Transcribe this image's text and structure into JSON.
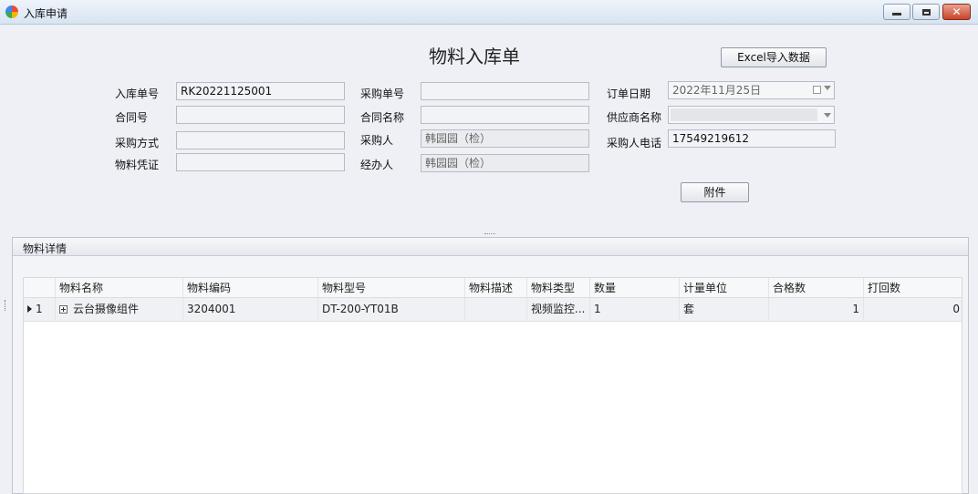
{
  "window": {
    "title": "入库申请"
  },
  "form": {
    "title": "物料入库单",
    "excel_button": "Excel导入数据",
    "attach_button": "附件",
    "fields": {
      "inbound_no": {
        "label": "入库单号",
        "value": "RK20221125001"
      },
      "contract_no": {
        "label": "合同号",
        "value": ""
      },
      "purchase_method": {
        "label": "采购方式",
        "value": ""
      },
      "material_voucher": {
        "label": "物料凭证",
        "value": ""
      },
      "purchase_no": {
        "label": "采购单号",
        "value": ""
      },
      "contract_name": {
        "label": "合同名称",
        "value": ""
      },
      "purchaser": {
        "label": "采购人",
        "value": "韩园园（检）"
      },
      "handler": {
        "label": "经办人",
        "value": "韩园园（检）"
      },
      "order_date": {
        "label": "订单日期",
        "value": "2022年11月25日"
      },
      "supplier_name": {
        "label": "供应商名称",
        "value": ""
      },
      "purchaser_phone": {
        "label": "采购人电话",
        "value": "17549219612"
      }
    }
  },
  "details": {
    "title": "物料详情",
    "columns": [
      "物料名称",
      "物料编码",
      "物料型号",
      "物料描述",
      "物料类型",
      "数量",
      "计量单位",
      "合格数",
      "打回数"
    ],
    "rows": [
      {
        "index": "1",
        "name": "云台摄像组件",
        "code": "3204001",
        "model": "DT-200-YT01B",
        "description": "",
        "type": "视频监控...",
        "quantity": "1",
        "unit": "套",
        "qualified": "1",
        "returned": "0"
      }
    ]
  },
  "icons": {
    "app": "app-logo-icon",
    "minimize": "minimize-icon",
    "maximize": "maximize-icon",
    "close": "close-icon",
    "calendar": "calendar-icon",
    "dropdown": "chevron-down-icon",
    "expand": "expand-plus-icon",
    "row_indicator": "row-indicator-icon"
  },
  "colors": {
    "background": "#eef0f5",
    "close_button": "#c9432a",
    "grid_header": "#f7f8fa"
  }
}
